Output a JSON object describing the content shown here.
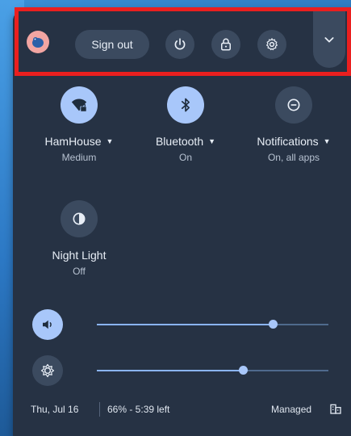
{
  "top_bar": {
    "sign_out_label": "Sign out",
    "icons": [
      "avatar-icon",
      "power-icon",
      "lock-icon",
      "gear-icon",
      "chevron-down-icon"
    ]
  },
  "tiles": [
    {
      "label": "HamHouse",
      "sub": "Medium",
      "icon": "wifi-lock-icon",
      "state": "on"
    },
    {
      "label": "Bluetooth",
      "sub": "On",
      "icon": "bluetooth-icon",
      "state": "on"
    },
    {
      "label": "Notifications",
      "sub": "On, all apps",
      "icon": "notifications-icon",
      "state": "off"
    },
    {
      "label": "Night Light",
      "sub": "Off",
      "icon": "night-light-icon",
      "state": "off"
    }
  ],
  "sliders": {
    "volume_level": 0.76,
    "brightness_level": 0.63
  },
  "footer": {
    "date": "Thu, Jul 16",
    "battery": "66% - 5:39 left",
    "managed": "Managed"
  },
  "colors": {
    "panel": "#263244",
    "button": "#3b4a5f",
    "accent": "#a8c7fa",
    "highlight": "#ea1f1f"
  }
}
